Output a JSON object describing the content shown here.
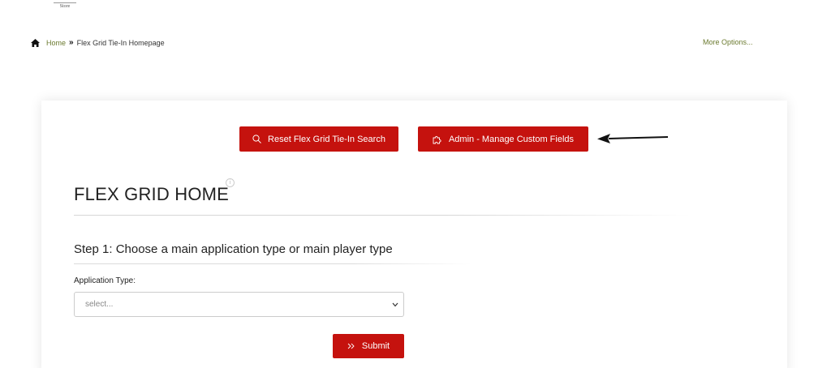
{
  "logo": {
    "text": "Store"
  },
  "breadcrumb": {
    "home": "Home",
    "separator": "»",
    "current": "Flex Grid Tie-In Homepage"
  },
  "header": {
    "more_options": "More Options..."
  },
  "toolbar": {
    "reset_label": "Reset Flex Grid Tie-In Search",
    "admin_label": "Admin - Manage Custom Fields"
  },
  "page": {
    "title": "FLEX GRID HOME",
    "step1": "Step 1: Choose a main application type or main player type"
  },
  "form": {
    "application_type_label": "Application Type:",
    "application_type_value": "select...",
    "submit_label": "Submit"
  },
  "colors": {
    "accent": "#c5120e",
    "link": "#6b7a2f"
  },
  "icons": {
    "home": "home-icon",
    "reset": "search-icon",
    "admin": "puzzle-icon",
    "submit": "double-chevron-right-icon",
    "info": "info-icon"
  }
}
